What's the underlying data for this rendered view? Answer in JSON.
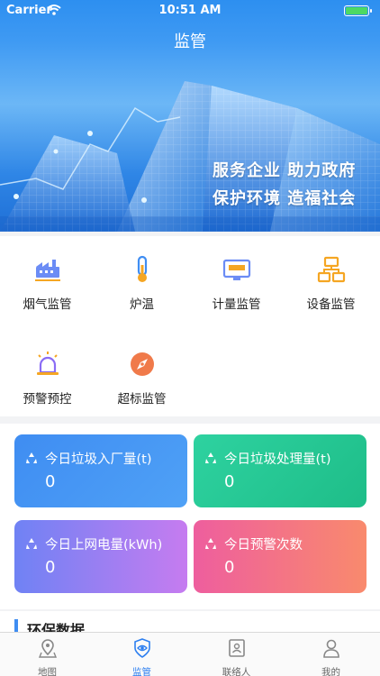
{
  "status_bar": {
    "carrier": "Carrier",
    "time": "10:51 AM"
  },
  "header": {
    "title": "监管"
  },
  "banner": {
    "slogan_line1": "服务企业  助力政府",
    "slogan_line2": "保护环境  造福社会"
  },
  "menu": {
    "items": [
      {
        "label": "烟气监管",
        "icon": "factory-smoke-icon"
      },
      {
        "label": "炉温",
        "icon": "thermometer-icon"
      },
      {
        "label": "计量监管",
        "icon": "meter-icon"
      },
      {
        "label": "设备监管",
        "icon": "equipment-icon"
      },
      {
        "label": "预警预控",
        "icon": "alarm-light-icon"
      },
      {
        "label": "超标监管",
        "icon": "compass-icon"
      }
    ]
  },
  "stats": {
    "cards": [
      {
        "title": "今日垃圾入厂量(t)",
        "value": "0"
      },
      {
        "title": "今日垃圾处理量(t)",
        "value": "0"
      },
      {
        "title": "今日上网电量(kWh)",
        "value": "0"
      },
      {
        "title": "今日预警次数",
        "value": "0"
      }
    ]
  },
  "section": {
    "title": "环保数据"
  },
  "tabbar": {
    "tabs": [
      {
        "label": "地图",
        "icon": "map-pin-icon"
      },
      {
        "label": "监管",
        "icon": "eye-shield-icon",
        "active": true
      },
      {
        "label": "联络人",
        "icon": "contact-card-icon"
      },
      {
        "label": "我的",
        "icon": "user-icon"
      }
    ]
  },
  "colors": {
    "accent": "#2d7ff0",
    "card1": "#3f8df2",
    "card2": "#22c492",
    "card3": "#9b7ff2",
    "card4": "#f4707f"
  }
}
